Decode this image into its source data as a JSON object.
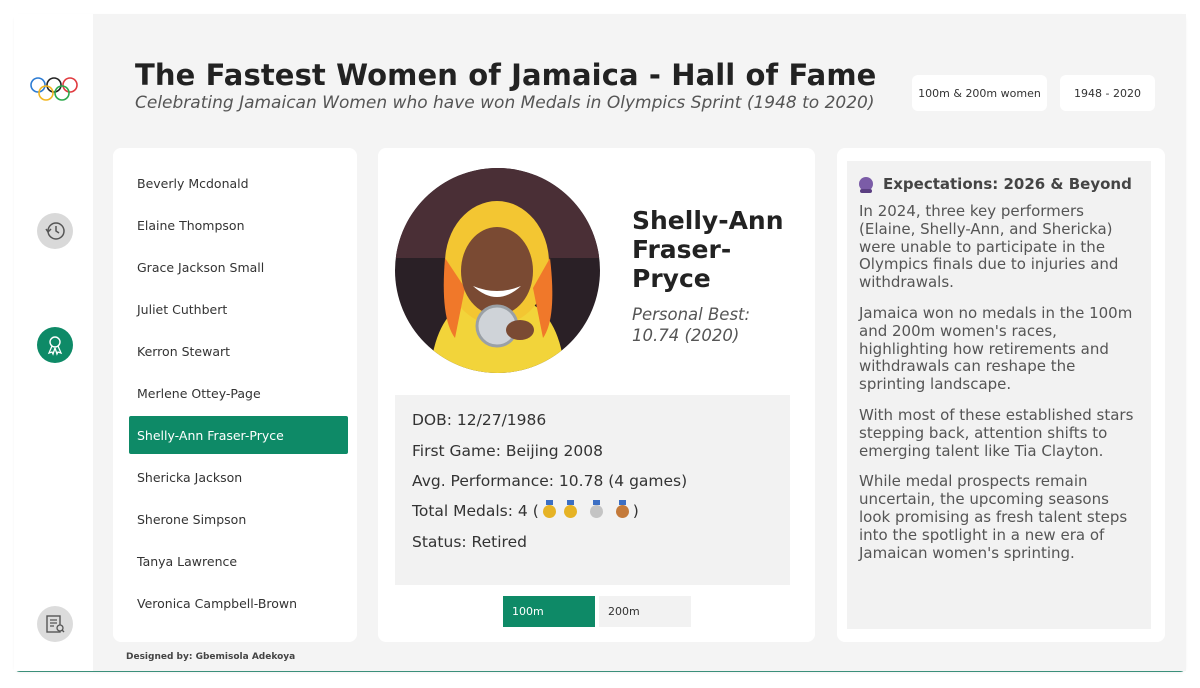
{
  "header": {
    "title": "The Fastest Women of Jamaica - Hall of Fame",
    "subtitle": "Celebrating Jamaican Women who have won Medals in Olympics Sprint (1948 to 2020)",
    "chips": [
      "100m & 200m women",
      "1948 - 2020"
    ]
  },
  "rail": {
    "icons": [
      "olympic-rings-icon",
      "history-icon",
      "medal-icon",
      "report-icon"
    ]
  },
  "athletes": {
    "items": [
      "Beverly Mcdonald",
      "Elaine Thompson",
      "Grace Jackson Small",
      "Juliet Cuthbert",
      "Kerron Stewart",
      "Merlene Ottey-Page",
      "Shelly-Ann Fraser-Pryce",
      "Shericka Jackson",
      "Sherone Simpson",
      "Tanya Lawrence",
      "Veronica Campbell-Brown"
    ],
    "selected_index": 6
  },
  "profile": {
    "name": "Shelly-Ann Fraser-Pryce",
    "personal_best": "Personal Best: 10.74 (2020)",
    "dob": "DOB: 12/27/1986",
    "first_game": "First Game: Beijing 2008",
    "avg_performance": "Avg. Performance: 10.78 (4 games)",
    "total_medals_label": "Total Medals: 4 (",
    "medals": [
      "gold",
      "gold",
      "silver",
      "bronze"
    ],
    "total_medals_close": ")",
    "status": "Status: Retired",
    "tabs": [
      "100m",
      "200m"
    ],
    "active_tab": "100m"
  },
  "expectations": {
    "heading": "Expectations: 2026 & Beyond",
    "paragraphs": [
      "In 2024, three key performers (Elaine, Shelly-Ann, and Shericka) were unable to participate in the Olympics finals due to injuries and withdrawals.",
      "Jamaica won no medals in the 100m and 200m women's races, highlighting how retirements and withdrawals can reshape the sprinting landscape.",
      "With most of these established stars stepping back, attention shifts to emerging talent like Tia Clayton.",
      "While medal prospects remain uncertain, the upcoming seasons look promising as fresh talent steps into the spotlight in a new era of Jamaican women's sprinting."
    ]
  },
  "footer": {
    "credit": "Designed by: Gbemisola Adekoya"
  },
  "colors": {
    "accent": "#0e8a67",
    "background": "#f4f4f4",
    "card": "#ffffff",
    "panel": "#f2f2f2"
  }
}
